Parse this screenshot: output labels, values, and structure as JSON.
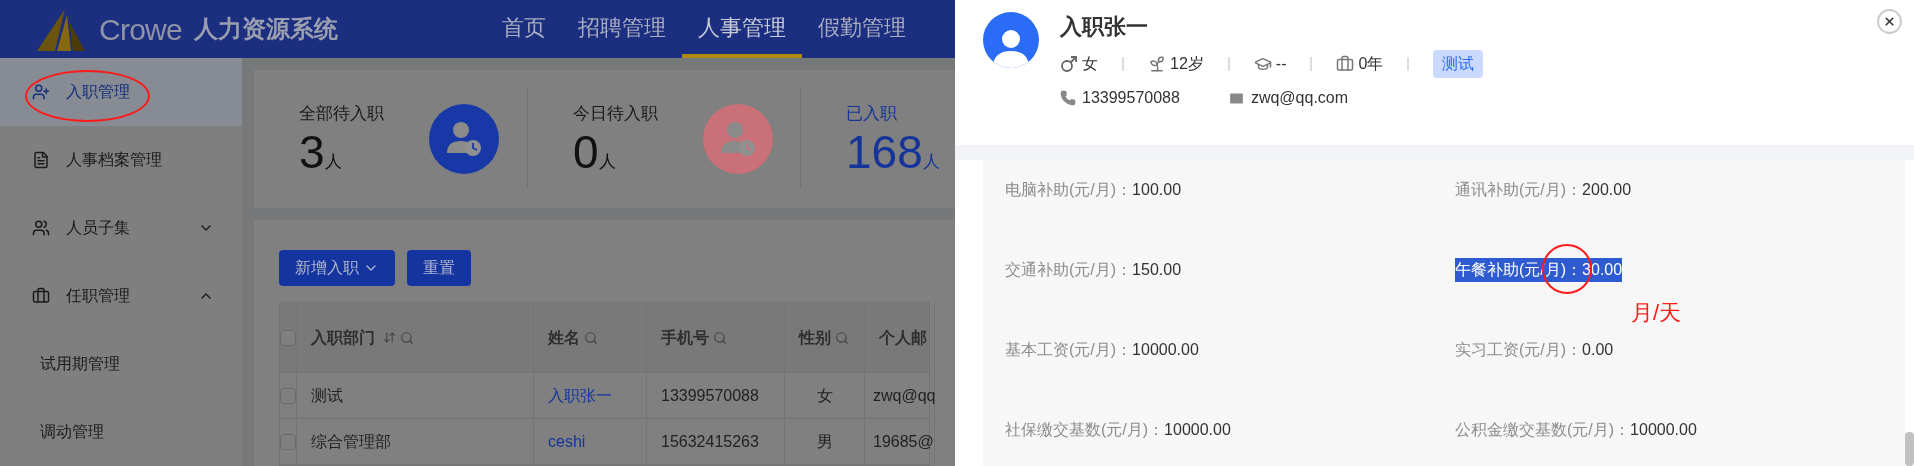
{
  "header": {
    "logo_text": "Crowe",
    "system_title": "人力资源系统",
    "nav": [
      {
        "label": "首页",
        "selected": false
      },
      {
        "label": "招聘管理",
        "selected": false
      },
      {
        "label": "人事管理",
        "selected": true
      },
      {
        "label": "假勤管理",
        "selected": false
      }
    ]
  },
  "sidebar": {
    "items": [
      {
        "label": "入职管理",
        "kind": "page",
        "selected": true,
        "circled": true
      },
      {
        "label": "人事档案管理",
        "kind": "page",
        "selected": false,
        "circled": false
      },
      {
        "label": "人员子集",
        "kind": "group",
        "selected": false,
        "circled": false,
        "expanded": false
      },
      {
        "label": "任职管理",
        "kind": "group",
        "selected": false,
        "circled": false,
        "expanded": true,
        "children": [
          {
            "label": "试用期管理",
            "selected": false
          },
          {
            "label": "调动管理",
            "selected": false
          }
        ]
      }
    ]
  },
  "stats": [
    {
      "label": "全部待入职",
      "value": "3",
      "unit": "人",
      "accent": false,
      "color": "#1838a8"
    },
    {
      "label": "今日待入职",
      "value": "0",
      "unit": "人",
      "accent": false,
      "color": "#c97078"
    },
    {
      "label": "已入职",
      "value": "168",
      "unit": "人",
      "accent": true
    }
  ],
  "toolbar": [
    {
      "label": "新增入职",
      "kind": "dropdown"
    },
    {
      "label": "重置",
      "kind": "button"
    }
  ],
  "table": {
    "select_all_checked": false,
    "columns": [
      {
        "label": "入职部门",
        "sortable": true,
        "filterable": true
      },
      {
        "label": "姓名",
        "sortable": false,
        "filterable": true
      },
      {
        "label": "手机号",
        "sortable": false,
        "filterable": true
      },
      {
        "label": "性别",
        "sortable": false,
        "filterable": true
      },
      {
        "label": "个人邮",
        "sortable": false,
        "filterable": false
      }
    ],
    "rows": [
      {
        "checked": false,
        "cells": [
          "测试",
          "入职张一",
          "13399570088",
          "女",
          "zwq@qq"
        ]
      },
      {
        "checked": false,
        "cells": [
          "综合管理部",
          "ceshi",
          "15632415263",
          "男",
          "19685@"
        ]
      }
    ]
  },
  "drawer": {
    "name": "入职张一",
    "meta": [
      {
        "kind": "gender",
        "text": "女"
      },
      {
        "kind": "age",
        "text": "12岁"
      },
      {
        "kind": "education",
        "text": "--"
      },
      {
        "kind": "experience",
        "text": "0年"
      }
    ],
    "tag": "测试",
    "phone": "13399570088",
    "email": "zwq@qq.com",
    "fields": [
      {
        "label": "电脑补助(元/月)：",
        "value": "100.00",
        "selected": false,
        "circled": false
      },
      {
        "label": "通讯补助(元/月)：",
        "value": "200.00",
        "selected": false,
        "circled": false
      },
      {
        "label": "交通补助(元/月)：",
        "value": "150.00",
        "selected": false,
        "circled": false
      },
      {
        "label": "午餐补助(元/月)：",
        "value": "30.00",
        "selected": true,
        "circled": true,
        "note": "月/天"
      },
      {
        "label": "基本工资(元/月)：",
        "value": "10000.00",
        "selected": false,
        "circled": false
      },
      {
        "label": "实习工资(元/月)：",
        "value": "0.00",
        "selected": false,
        "circled": false
      },
      {
        "label": "社保缴交基数(元/月)：",
        "value": "10000.00",
        "selected": false,
        "circled": false
      },
      {
        "label": "公积金缴交基数(元/月)：",
        "value": "10000.00",
        "selected": false,
        "circled": false
      }
    ]
  }
}
